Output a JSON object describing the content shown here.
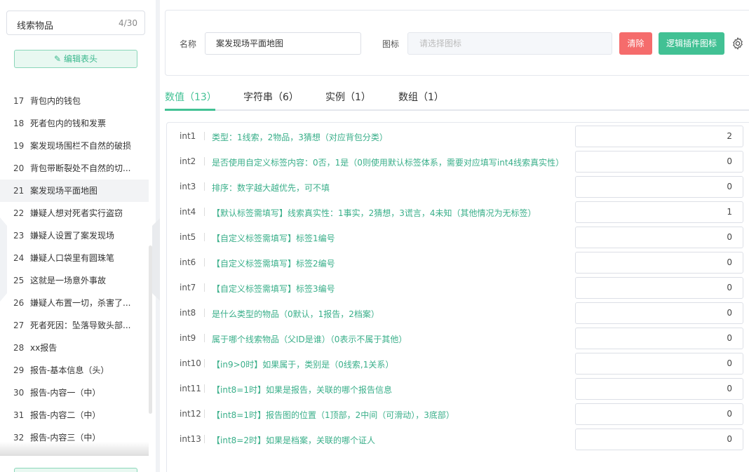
{
  "sidebar": {
    "search_text": "线索物品",
    "search_count": "4/30",
    "edit_header_label": "编辑表头",
    "items": [
      {
        "num": "17",
        "label": "背包内的钱包"
      },
      {
        "num": "18",
        "label": "死者包内的钱和发票"
      },
      {
        "num": "19",
        "label": "案发现场围栏不自然的破损"
      },
      {
        "num": "20",
        "label": "背包带断裂处不自然的切..."
      },
      {
        "num": "21",
        "label": "案发现场平面地图"
      },
      {
        "num": "22",
        "label": "嫌疑人想对死者实行盗窃"
      },
      {
        "num": "23",
        "label": "嫌疑人设置了案发现场"
      },
      {
        "num": "24",
        "label": "嫌疑人口袋里有圆珠笔"
      },
      {
        "num": "25",
        "label": "这就是一场意外事故"
      },
      {
        "num": "26",
        "label": "嫌疑人布置一切，杀害了..."
      },
      {
        "num": "27",
        "label": "死者死因：坠落导致头部..."
      },
      {
        "num": "28",
        "label": "xx报告"
      },
      {
        "num": "29",
        "label": "报告-基本信息（头）"
      },
      {
        "num": "30",
        "label": "报告-内容一（中）"
      },
      {
        "num": "31",
        "label": "报告-内容二（中）"
      },
      {
        "num": "32",
        "label": "报告-内容三（中）"
      }
    ],
    "active_index": 4
  },
  "header": {
    "name_label": "名称",
    "name_value": "案发现场平面地图",
    "icon_label": "图标",
    "icon_placeholder": "请选择图标",
    "clear_label": "清除",
    "plugin_icon_label": "逻辑插件图标"
  },
  "tabs": [
    {
      "label": "数值（13）",
      "active": true
    },
    {
      "label": "字符串（6）",
      "active": false
    },
    {
      "label": "实例（1）",
      "active": false
    },
    {
      "label": "数组（1）",
      "active": false
    }
  ],
  "fields": [
    {
      "key": "int1",
      "desc": "类型：1线索，2物品，3猜想（对应背包分类）",
      "value": "2"
    },
    {
      "key": "int2",
      "desc": "是否使用自定义标签内容：0否，1是（0则使用默认标签体系，需要对应填写int4线索真实性）",
      "value": "0"
    },
    {
      "key": "int3",
      "desc": "排序：数字越大越优先，可不填",
      "value": "0"
    },
    {
      "key": "int4",
      "desc": "【默认标签需填写】线索真实性：1事实，2猜想，3谎言，4未知（其他情况为无标签）",
      "value": "1"
    },
    {
      "key": "int5",
      "desc": "【自定义标签需填写】标签1编号",
      "value": "0"
    },
    {
      "key": "int6",
      "desc": "【自定义标签需填写】标签2编号",
      "value": "0"
    },
    {
      "key": "int7",
      "desc": "【自定义标签需填写】标签3编号",
      "value": "0"
    },
    {
      "key": "int8",
      "desc": "是什么类型的物品（0默认，1报告，2档案）",
      "value": "0"
    },
    {
      "key": "int9",
      "desc": "属于哪个线索物品（父ID是谁）（0表示不属于其他）",
      "value": "0"
    },
    {
      "key": "int10",
      "desc": "【in9>0时】如果属于，类别是（0线索,1关系）",
      "value": "0"
    },
    {
      "key": "int11",
      "desc": "【int8=1时】如果是报告，关联的哪个报告信息",
      "value": "0"
    },
    {
      "key": "int12",
      "desc": "【int8=1时】报告图的位置（1顶部，2中间（可滑动），3底部）",
      "value": "0"
    },
    {
      "key": "int13",
      "desc": "【int8=2时】如果是档案，关联的哪个证人",
      "value": "0"
    }
  ],
  "colors": {
    "accent": "#42c194",
    "danger": "#f56c6c",
    "desc_text": "#3aaf8a"
  }
}
